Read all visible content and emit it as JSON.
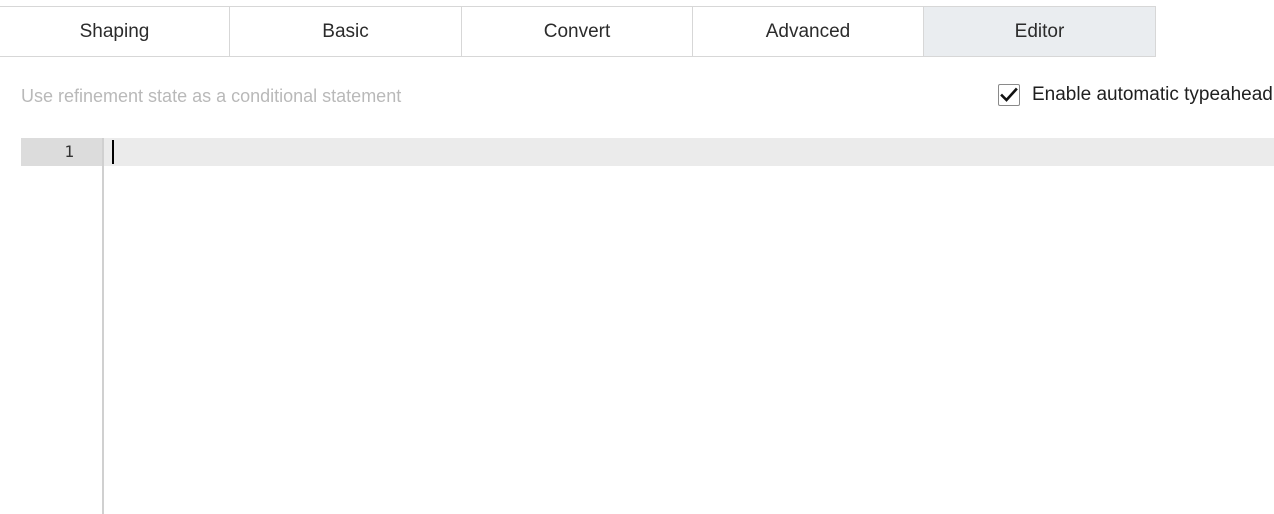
{
  "tabs": [
    {
      "label": "Shaping",
      "active": false
    },
    {
      "label": "Basic",
      "active": false
    },
    {
      "label": "Convert",
      "active": false
    },
    {
      "label": "Advanced",
      "active": false
    },
    {
      "label": "Editor",
      "active": true
    }
  ],
  "hint": {
    "text": "Use refinement state as a conditional statement"
  },
  "typeahead": {
    "label": "Enable automatic typeahead",
    "checked": true,
    "icon": "checkmark-icon"
  },
  "editor": {
    "lines": [
      {
        "number": "1",
        "text": ""
      }
    ]
  },
  "colors": {
    "active_tab": "#eaedf0",
    "hint_text": "#b9b9b9",
    "gutter": "#dcdcdc",
    "active_line": "#ebebeb"
  }
}
